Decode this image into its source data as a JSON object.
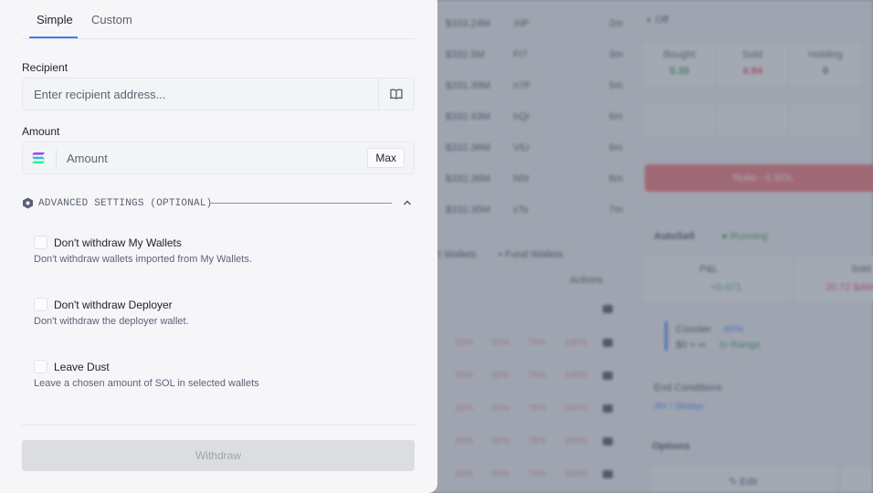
{
  "tabs": [
    {
      "label": "Simple",
      "active": true
    },
    {
      "label": "Custom",
      "active": false
    }
  ],
  "recipient": {
    "label": "Recipient",
    "placeholder": "Enter recipient address...",
    "value": "",
    "icon": "address-book-icon"
  },
  "amount": {
    "label": "Amount",
    "placeholder": "Amount",
    "value": "",
    "token_icon": "solana-icon",
    "max_label": "Max"
  },
  "advanced": {
    "label": "ADVANCED SETTINGS (OPTIONAL)",
    "expanded": true,
    "options": [
      {
        "title": "Don't withdraw My Wallets",
        "description": "Don't withdraw wallets imported from My Wallets.",
        "checked": false
      },
      {
        "title": "Don't withdraw Deployer",
        "description": "Don't withdraw the deployer wallet.",
        "checked": false
      },
      {
        "title": "Leave Dust",
        "description": "Leave a chosen amount of SOL in selected wallets",
        "checked": false
      }
    ]
  },
  "withdraw_label": "Withdraw",
  "colors": {
    "accent": "#3a7afe",
    "disabled_button": "#dcdde1",
    "panel_bg": "#f6f6f9"
  },
  "background": {
    "ticker": [
      {
        "value": "$333.24M",
        "symbol": "XiP",
        "age": "2m"
      },
      {
        "value": "$332.5M",
        "symbol": "FI7",
        "age": "3m"
      },
      {
        "value": "$331.39M",
        "symbol": "n7F",
        "age": "5m"
      },
      {
        "value": "$332.43M",
        "symbol": "hQr",
        "age": "6m"
      },
      {
        "value": "$332.36M",
        "symbol": "ViU",
        "age": "6m"
      },
      {
        "value": "$332.36M",
        "symbol": "N5t",
        "age": "6m"
      },
      {
        "value": "$332.35M",
        "symbol": "xTs",
        "age": "7m"
      }
    ],
    "wallet_tabs": [
      "t Wallets",
      "Fund Wallets"
    ],
    "actions_label": "Actions",
    "percent_labels": [
      "25%",
      "50%",
      "75%",
      "100%"
    ],
    "off_label": "Off",
    "stats": [
      {
        "label": "Bought",
        "value": "5.35"
      },
      {
        "label": "Sold",
        "value": "4.94"
      },
      {
        "label": "Holding",
        "value": "0"
      }
    ],
    "nuke_label": "Nuke - 0 SOL",
    "autosell_label": "AutoSell",
    "running_label": "Running",
    "pnl_label": "P&L",
    "pnl_value": "+0.071",
    "sold_label": "Sold",
    "sold_value": "20.72 $AM",
    "counter_label": "Counter",
    "counter_badge": "40%",
    "counter_range": "$0 + ∞",
    "in_range_label": "In Range",
    "end_conditions_label": "End Conditions",
    "end_conditions_value": "3hr / 28days",
    "options_label": "Options",
    "edit_label": "Edit"
  }
}
